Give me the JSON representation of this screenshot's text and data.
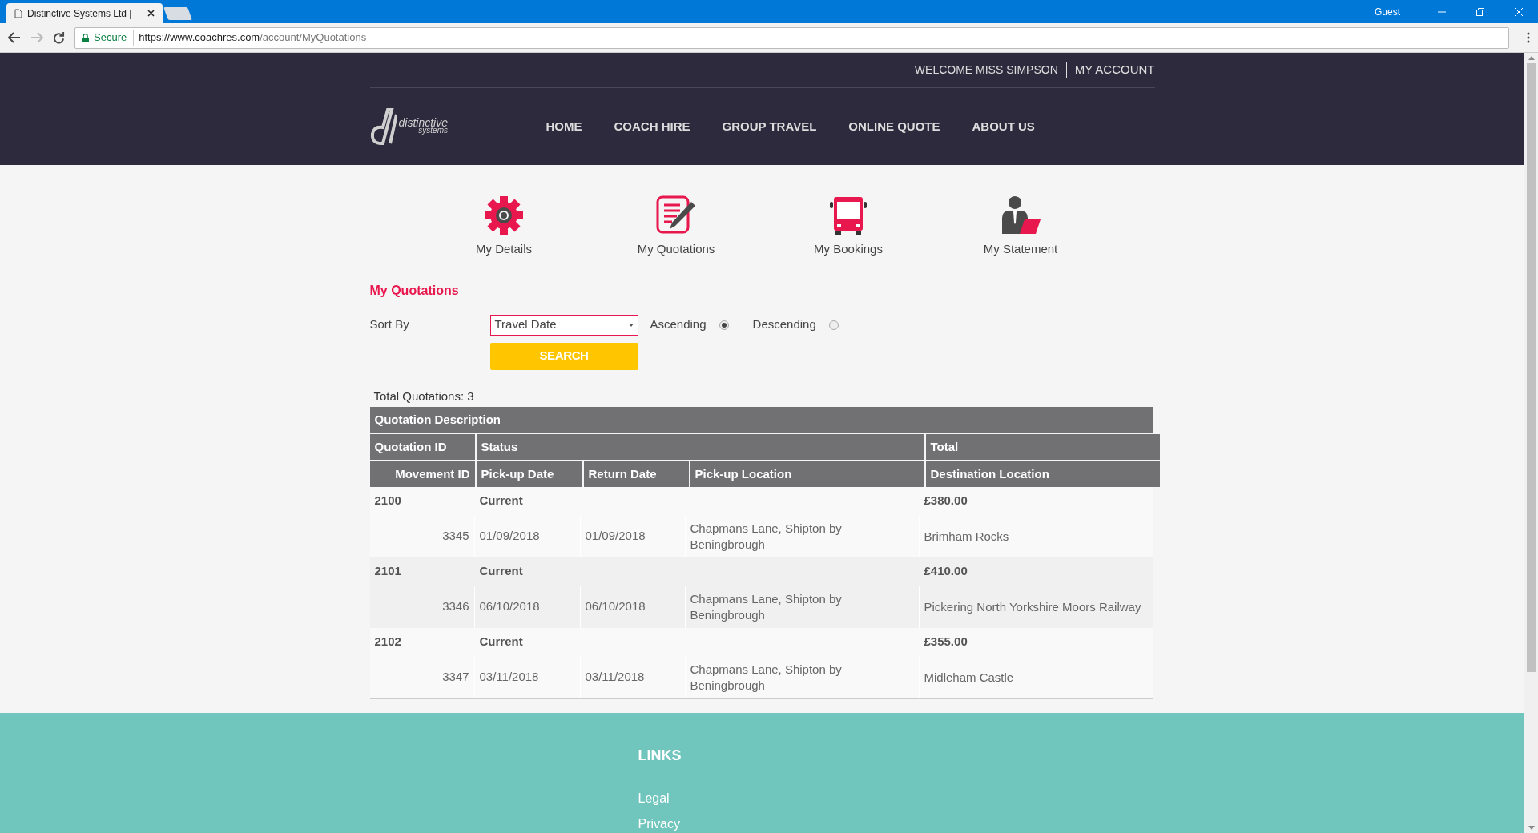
{
  "browser": {
    "tab_title": "Distinctive Systems Ltd |",
    "user": "Guest",
    "secure_label": "Secure",
    "url_host": "https://www.coachres.com",
    "url_path": "/account/MyQuotations"
  },
  "header": {
    "welcome": "WELCOME MISS SIMPSON",
    "account_link": "MY ACCOUNT",
    "logo": {
      "line1": "distinctive",
      "line2": "systems"
    },
    "nav": [
      "HOME",
      "COACH HIRE",
      "GROUP TRAVEL",
      "ONLINE QUOTE",
      "ABOUT US"
    ]
  },
  "account_menu": [
    {
      "kind": "gear",
      "label": "My Details"
    },
    {
      "kind": "notepad",
      "label": "My Quotations"
    },
    {
      "kind": "bus",
      "label": "My Bookings"
    },
    {
      "kind": "person",
      "label": "My Statement"
    }
  ],
  "page_title": "My Quotations",
  "sort": {
    "label": "Sort By",
    "select_value": "Travel Date",
    "orders": [
      {
        "label": "Ascending",
        "selected": true
      },
      {
        "label": "Descending",
        "selected": false
      }
    ],
    "button": "SEARCH"
  },
  "total": "Total Quotations: 3",
  "table": {
    "title": "Quotation Description",
    "columns_quotation": [
      "Quotation ID",
      "Status",
      "Total"
    ],
    "columns_movement": [
      "Movement ID",
      "Pick-up Date",
      "Return Date",
      "Pick-up Location",
      "Destination Location"
    ],
    "quotations": [
      {
        "id": "2100",
        "status": "Current",
        "total": "£380.00",
        "movements": [
          {
            "movement_id": "3345",
            "pickup_date": "01/09/2018",
            "return_date": "01/09/2018",
            "pickup_location": "Chapmans Lane, Shipton by Beningbrough",
            "destination": "Brimham Rocks"
          }
        ]
      },
      {
        "id": "2101",
        "status": "Current",
        "total": "£410.00",
        "movements": [
          {
            "movement_id": "3346",
            "pickup_date": "06/10/2018",
            "return_date": "06/10/2018",
            "pickup_location": "Chapmans Lane, Shipton by Beningbrough",
            "destination": "Pickering North Yorkshire Moors Railway"
          }
        ]
      },
      {
        "id": "2102",
        "status": "Current",
        "total": "£355.00",
        "movements": [
          {
            "movement_id": "3347",
            "pickup_date": "03/11/2018",
            "return_date": "03/11/2018",
            "pickup_location": "Chapmans Lane, Shipton by Beningbrough",
            "destination": "Midleham Castle"
          }
        ]
      }
    ]
  },
  "footer": {
    "heading": "LINKS",
    "links": [
      "Legal",
      "Privacy"
    ]
  }
}
